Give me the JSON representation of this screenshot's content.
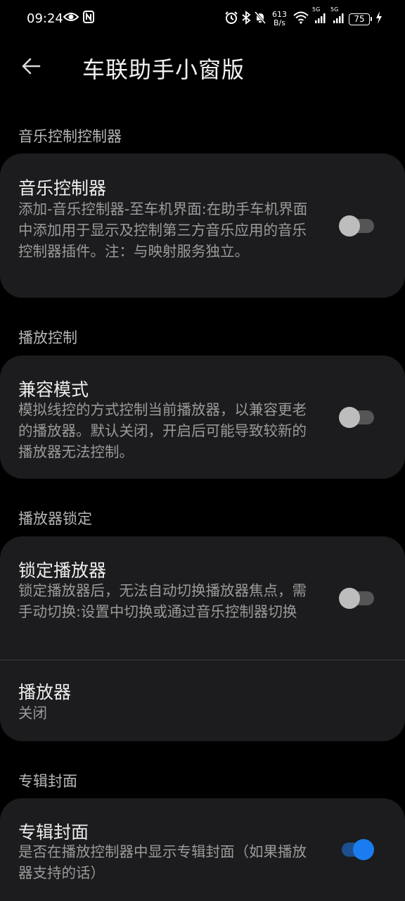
{
  "status_bar": {
    "time": "09:24",
    "speed_value": "613",
    "speed_unit": "B/s",
    "battery": "75",
    "network_label_1": "5G",
    "network_label_2": "5G"
  },
  "app_bar": {
    "title": "车联助手小窗版"
  },
  "sections": {
    "music": {
      "header": "音乐控制控制器",
      "title": "音乐控制器",
      "description": "添加-音乐控制器-至车机界面:在助手车机界面中添加用于显示及控制第三方音乐应用的音乐控制器插件。注：与映射服务独立。",
      "toggle_on": false
    },
    "playback": {
      "header": "播放控制",
      "title": "兼容模式",
      "description": "模拟线控的方式控制当前播放器，以兼容更老的播放器。默认关闭，开启后可能导致较新的播放器无法控制。",
      "toggle_on": false
    },
    "lock": {
      "header": "播放器锁定",
      "title": "锁定播放器",
      "description": "锁定播放器后，无法自动切换播放器焦点，需手动切换:设置中切换或通过音乐控制器切换",
      "toggle_on": false,
      "player_title": "播放器",
      "player_value": "关闭"
    },
    "album": {
      "header": "专辑封面",
      "title": "专辑封面",
      "description": "是否在播放控制器中显示专辑封面（如果播放器支持的话）",
      "toggle_on": true
    }
  },
  "colors": {
    "background": "#000000",
    "card": "#1c1c1e",
    "accent": "#1a7cf0",
    "section_header": "#b7b7b7",
    "description": "#9a9a9a"
  },
  "icons": {
    "back": "arrow-left-icon",
    "eye": "eye-icon",
    "nfc": "nfc-icon",
    "alarm": "alarm-icon",
    "bluetooth": "bluetooth-icon",
    "mute": "bell-off-icon",
    "wifi": "wifi-icon",
    "signal": "signal-icon",
    "charging": "bolt-icon"
  }
}
